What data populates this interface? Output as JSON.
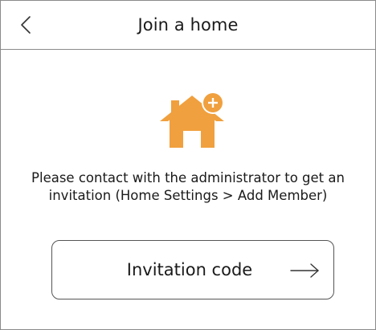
{
  "header": {
    "title": "Join a home",
    "back_icon": "chevron-left-icon"
  },
  "illustration": {
    "icon": "home-add-icon",
    "color": "#F0A03E"
  },
  "instruction": {
    "line1": "Please contact with the administrator to get an",
    "line2": "invitation (Home Settings > Add Member)"
  },
  "code_button": {
    "label": "Invitation code",
    "icon": "arrow-right-icon"
  }
}
